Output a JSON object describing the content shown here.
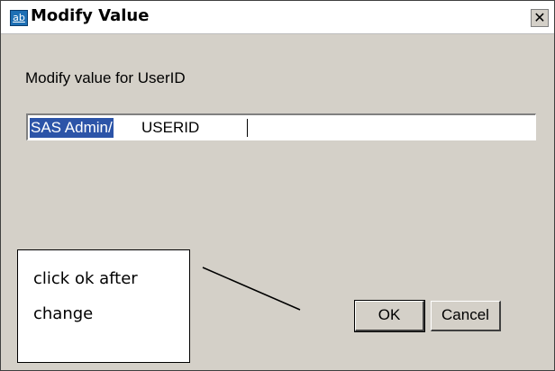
{
  "window": {
    "title": "Modify Value",
    "icon": "ab-string-value-icon",
    "close_symbol": "✕"
  },
  "dialog": {
    "prompt": "Modify value for UserID",
    "value_selected": "SAS Admin/",
    "value_rest": "USERID"
  },
  "buttons": {
    "ok_label": "OK",
    "cancel_label": "Cancel"
  },
  "annotation": {
    "text": "click ok after change"
  },
  "colors": {
    "selection": "#2c54a8",
    "dialog_background": "#d4d0c8"
  }
}
